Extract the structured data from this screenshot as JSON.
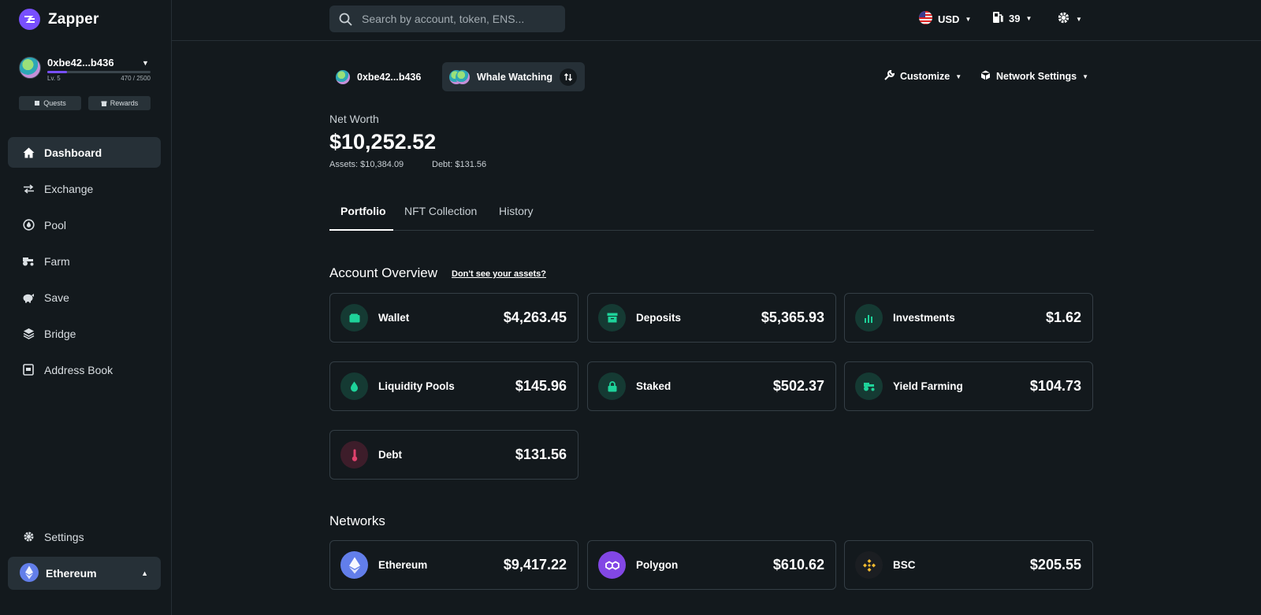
{
  "brand": {
    "name": "Zapper",
    "accent": "#784ffe"
  },
  "account": {
    "name": "0xbe42...b436",
    "level": "Lv. 5",
    "xp": "470 / 2500",
    "xp_fraction": 0.188
  },
  "buttons": {
    "quests": "Quests",
    "rewards": "Rewards"
  },
  "sidebar": {
    "items": [
      {
        "label": "Dashboard",
        "icon": "home-icon",
        "active": true
      },
      {
        "label": "Exchange",
        "icon": "exchange-icon"
      },
      {
        "label": "Pool",
        "icon": "pool-icon"
      },
      {
        "label": "Farm",
        "icon": "tractor-icon"
      },
      {
        "label": "Save",
        "icon": "piggy-bank-icon"
      },
      {
        "label": "Bridge",
        "icon": "layers-icon"
      },
      {
        "label": "Address Book",
        "icon": "address-book-icon"
      }
    ],
    "settings": "Settings",
    "network": "Ethereum"
  },
  "topbar": {
    "search_placeholder": "Search by account, token, ENS...",
    "currency": "USD",
    "gas": "39"
  },
  "header": {
    "account_pill": "0xbe42...b436",
    "bundle_pill": "Whale Watching",
    "customize": "Customize",
    "network_settings": "Network Settings"
  },
  "net_worth": {
    "label": "Net Worth",
    "value": "$10,252.52",
    "assets": "Assets: $10,384.09",
    "debt": "Debt: $131.56"
  },
  "tabs": [
    "Portfolio",
    "NFT Collection",
    "History"
  ],
  "overview": {
    "title": "Account Overview",
    "help": "Don't see your assets?",
    "cards": [
      {
        "label": "Wallet",
        "value": "$4,263.45",
        "icon": "wallet-icon"
      },
      {
        "label": "Deposits",
        "value": "$5,365.93",
        "icon": "archive-icon"
      },
      {
        "label": "Investments",
        "value": "$1.62",
        "icon": "bar-chart-icon"
      },
      {
        "label": "Liquidity Pools",
        "value": "$145.96",
        "icon": "droplet-icon"
      },
      {
        "label": "Staked",
        "value": "$502.37",
        "icon": "lock-icon"
      },
      {
        "label": "Yield Farming",
        "value": "$104.73",
        "icon": "tractor-icon"
      },
      {
        "label": "Debt",
        "value": "$131.56",
        "icon": "thermometer-icon"
      }
    ]
  },
  "networks": {
    "title": "Networks",
    "cards": [
      {
        "label": "Ethereum",
        "value": "$9,417.22",
        "icon": "ethereum-icon"
      },
      {
        "label": "Polygon",
        "value": "$610.62",
        "icon": "polygon-icon"
      },
      {
        "label": "BSC",
        "value": "$205.55",
        "icon": "bsc-icon"
      }
    ]
  },
  "colors": {
    "background": "#13191d",
    "panel": "#263037",
    "green_icon": "#1ed39a",
    "red_icon": "#e0426d"
  }
}
